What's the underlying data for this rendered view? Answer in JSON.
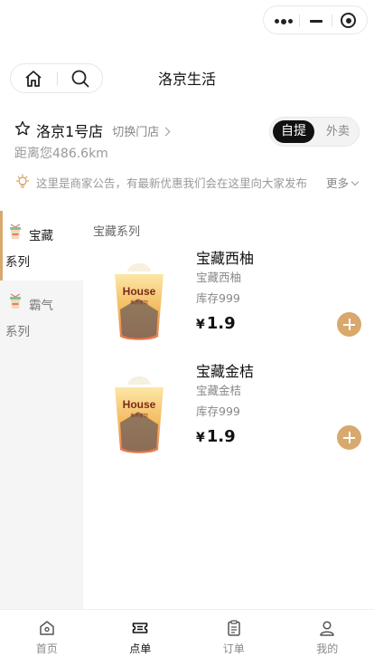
{
  "header": {
    "title": "洛京生活"
  },
  "capsule": {
    "more_icon": "more-dots-icon",
    "minimize_icon": "minimize-icon",
    "close_icon": "target-circle-icon"
  },
  "store": {
    "name": "洛京1号店",
    "switch_label": "切换门店",
    "distance": "距离您486.6km",
    "modes": {
      "pickup": "自提",
      "delivery": "外卖",
      "selected": "pickup"
    }
  },
  "notice": {
    "text": "这里是商家公告，有最新优惠我们会在这里向大家发布",
    "more_label": "更多"
  },
  "sidebar": {
    "items": [
      {
        "line1": "宝藏",
        "line2": "系列",
        "active": true
      },
      {
        "line1": "霸气",
        "line2": "系列",
        "active": false
      }
    ]
  },
  "menu": {
    "section_title": "宝藏系列",
    "products": [
      {
        "name": "宝藏西柚",
        "desc": "宝藏西柚",
        "stock": "库存999",
        "currency": "¥",
        "price": "1.9"
      },
      {
        "name": "宝藏金桔",
        "desc": "宝藏金桔",
        "stock": "库存999",
        "currency": "¥",
        "price": "1.9"
      }
    ]
  },
  "tabbar": {
    "items": [
      {
        "label": "首页",
        "icon": "home-icon",
        "active": false
      },
      {
        "label": "点单",
        "icon": "ticket-icon",
        "active": true
      },
      {
        "label": "订单",
        "icon": "clipboard-icon",
        "active": false
      },
      {
        "label": "我的",
        "icon": "user-icon",
        "active": false
      }
    ]
  },
  "colors": {
    "accent": "#d8a86d",
    "text": "#111111",
    "muted": "#888888",
    "sidebar_bg": "#f5f5f5"
  }
}
